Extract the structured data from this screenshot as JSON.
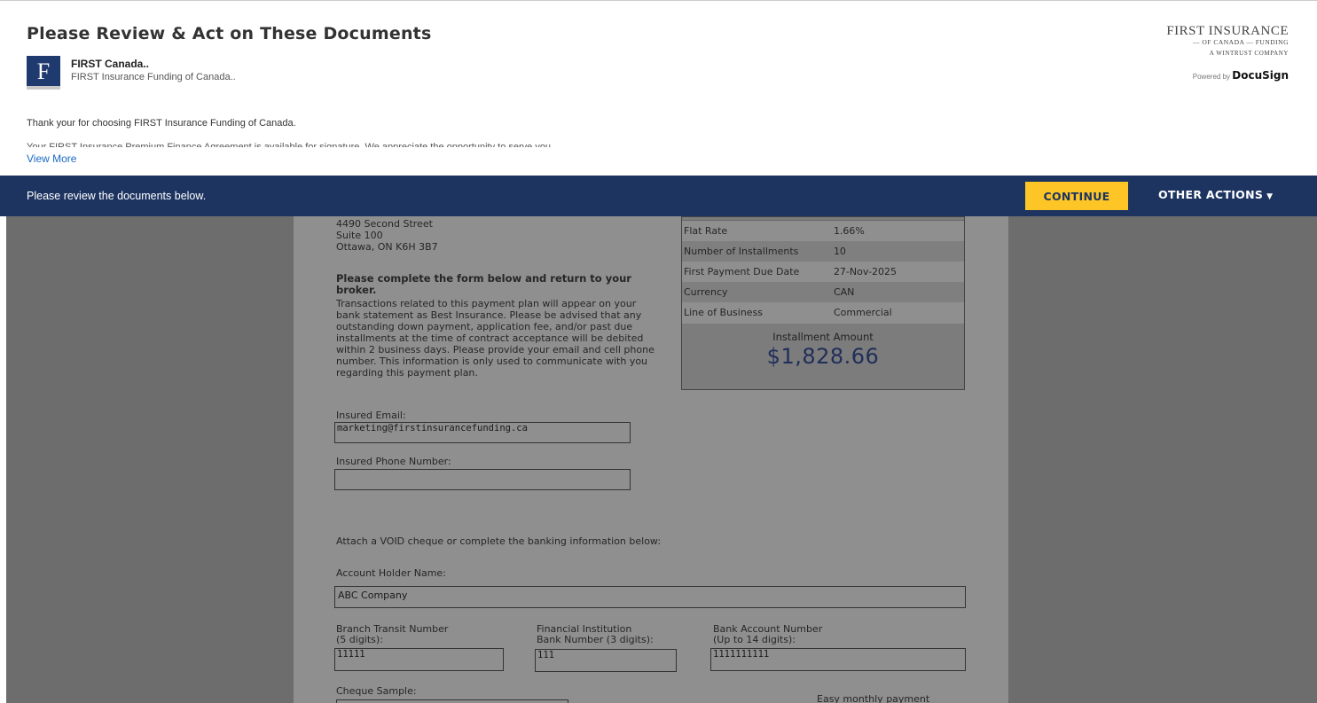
{
  "header": {
    "title": "Please Review & Act on These Documents",
    "sender": {
      "logo_letter": "F",
      "name": "FIRST Canada..",
      "company": "FIRST Insurance Funding of Canada.."
    },
    "brand": {
      "line1": "FIRST INSURANCE",
      "line2": "— OF CANADA — FUNDING",
      "line3": "A WINTRUST COMPANY",
      "powered_by": "Powered by",
      "docusign": "DocuSign"
    },
    "message": "Thank your for choosing FIRST Insurance Funding of Canada.",
    "message_cut": "Your FIRST Insurance Premium Finance Agreement is available for signature. We appreciate the opportunity to serve you.",
    "view_more": "View More"
  },
  "actionbar": {
    "text": "Please review the documents below.",
    "continue": "CONTINUE",
    "other_actions": "OTHER ACTIONS",
    "caret": "▼"
  },
  "document": {
    "address": {
      "line1": "4490 Second Street",
      "line2": "Suite 100",
      "line3": "Ottawa, ON K6H 3B7"
    },
    "instructions_title": "Please complete the form below and return to your broker.",
    "instructions_body": "Transactions related to this payment plan will appear on your bank statement as Best Insurance. Please be advised that any outstanding down payment, application fee, and/or past due installments at the time of contract acceptance will be debited within 2 business days. Please provide your email and cell phone number. This information is only used to communicate with you regarding this payment plan.",
    "email_label": "Insured Email:",
    "email_value": "marketing@firstinsurancefunding.ca",
    "phone_label": "Insured Phone Number:",
    "phone_value": "",
    "attach_text": "Attach a VOID cheque or complete the banking information below:",
    "holder_label": "Account Holder Name:",
    "holder_value": "ABC Company",
    "transit_label": "Branch Transit Number\n(5 digits):",
    "transit_value": "11111",
    "institution_label": "Financial Institution\nBank Number (3 digits):",
    "institution_value": "111",
    "account_label": "Bank Account Number\n(Up to 14 digits):",
    "account_value": "1111111111",
    "cheque_label": "Cheque Sample:",
    "easy_text": "Easy monthly payment",
    "summary": {
      "rows": [
        {
          "key": "Flat Rate",
          "value": "1.66%"
        },
        {
          "key": "Number of Installments",
          "value": "10"
        },
        {
          "key": "First Payment Due Date",
          "value": "27-Nov-2025"
        },
        {
          "key": "Currency",
          "value": "CAN"
        },
        {
          "key": "Line of Business",
          "value": "Commercial"
        }
      ],
      "installment_label": "Installment Amount",
      "installment_amount": "$1,828.66"
    }
  },
  "colors": {
    "action_bar": "#1d3461",
    "continue_button": "#fdc526",
    "link": "#1a6ac4",
    "amount": "#1f2e5a"
  }
}
